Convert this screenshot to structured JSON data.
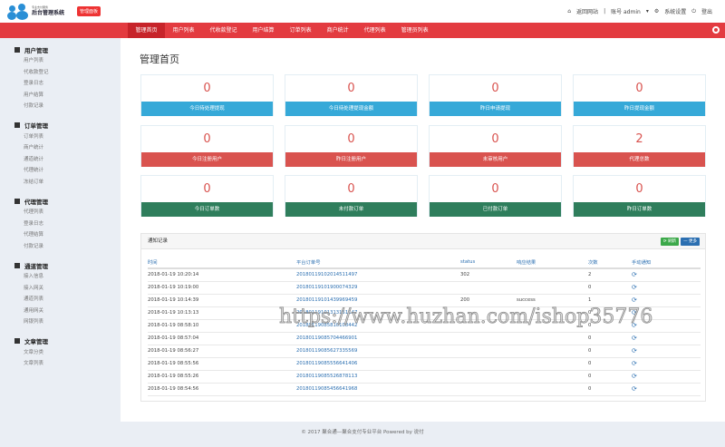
{
  "header": {
    "logo_small": "专业支付服务",
    "logo_title": "后台管理系统",
    "badge": "管理面板",
    "links": {
      "home": "返回网站",
      "account": "账号 admin",
      "settings": "系统设置",
      "logout": "登出"
    }
  },
  "nav": [
    "管理首页",
    "用户列表",
    "代收款登记",
    "用户结算",
    "订单列表",
    "商户统计",
    "代理列表",
    "管理员列表"
  ],
  "sidebar": [
    {
      "title": "用户管理",
      "items": [
        "用户列表",
        "代收款登记",
        "登录日志",
        "用户结算",
        "付款记录"
      ]
    },
    {
      "title": "订单管理",
      "items": [
        "订单列表",
        "商户统计",
        "通道统计",
        "代理统计",
        "冻结订单"
      ]
    },
    {
      "title": "代理管理",
      "items": [
        "代理列表",
        "登录日志",
        "代理结算",
        "付款记录"
      ]
    },
    {
      "title": "通道管理",
      "items": [
        "接入信息",
        "接入网关",
        "通道列表",
        "通用网关",
        "网银列表"
      ]
    },
    {
      "title": "文章管理",
      "items": [
        "文章分类",
        "文章列表"
      ]
    }
  ],
  "page_title": "管理首页",
  "cards": [
    {
      "value": "0",
      "label": "今日待处理提现",
      "color": "blue"
    },
    {
      "value": "0",
      "label": "今日待处理提现金额",
      "color": "blue"
    },
    {
      "value": "0",
      "label": "昨日申请提现",
      "color": "blue"
    },
    {
      "value": "0",
      "label": "昨日提现金额",
      "color": "blue"
    },
    {
      "value": "0",
      "label": "今日注册用户",
      "color": "red"
    },
    {
      "value": "0",
      "label": "昨日注册用户",
      "color": "red"
    },
    {
      "value": "0",
      "label": "未审核用户",
      "color": "red"
    },
    {
      "value": "2",
      "label": "代理总数",
      "color": "red"
    },
    {
      "value": "0",
      "label": "今日订单数",
      "color": "green"
    },
    {
      "value": "0",
      "label": "未付款订单",
      "color": "green"
    },
    {
      "value": "0",
      "label": "已付款订单",
      "color": "green"
    },
    {
      "value": "0",
      "label": "昨日订单数",
      "color": "green"
    }
  ],
  "panel": {
    "title": "通知记录",
    "refresh": "刷新",
    "more": "更多",
    "columns": [
      "时间",
      "平台订单号",
      "status",
      "响应结果",
      "次数",
      "手动通知"
    ],
    "rows": [
      [
        "2018-01-19 10:20:14",
        "201801191020145114​97",
        "302",
        "",
        "2"
      ],
      [
        "2018-01-19 10:19:00",
        "20180119101900074329",
        "",
        "",
        "0"
      ],
      [
        "2018-01-19 10:14:39",
        "20180119101439969459",
        "200",
        "success",
        "1"
      ],
      [
        "2018-01-19 10:13:13",
        "20180119101313151147",
        "",
        "",
        "0"
      ],
      [
        "2018-01-19 08:58:10",
        "20180119085810108442",
        "",
        "",
        "0"
      ],
      [
        "2018-01-19 08:57:04",
        "20180119085704466901",
        "",
        "",
        "0"
      ],
      [
        "2018-01-19 08:56:27",
        "20180119085627335569",
        "",
        "",
        "0"
      ],
      [
        "2018-01-19 08:55:56",
        "20180119085556641406",
        "",
        "",
        "0"
      ],
      [
        "2018-01-19 08:55:26",
        "20180119085526878113",
        "",
        "",
        "0"
      ],
      [
        "2018-01-19 08:54:56",
        "20180119085456641968",
        "",
        "",
        "0"
      ]
    ]
  },
  "footer": "© 2017  聚合通—聚合支付专业平台 Powered by 说付",
  "watermark": "https://www.huzhan.com/ishop35776"
}
